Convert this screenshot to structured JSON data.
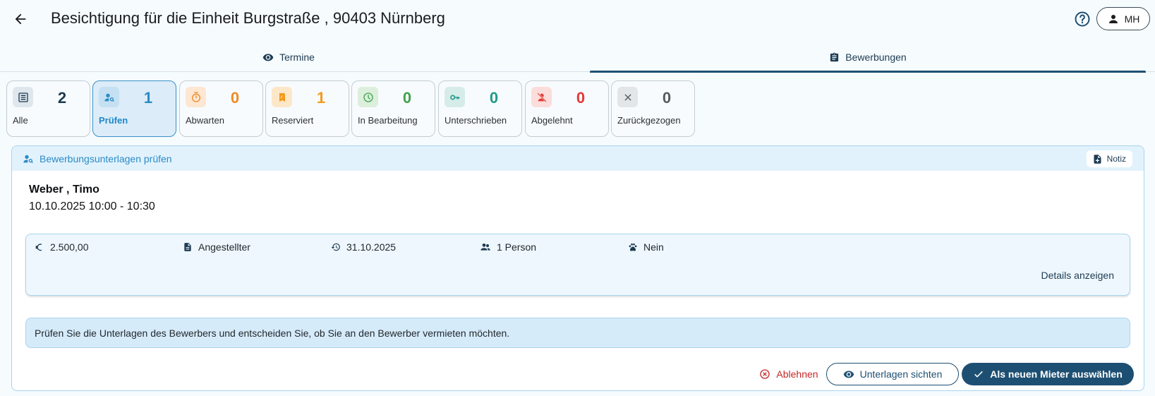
{
  "header": {
    "title": "Besichtigung für die Einheit Burgstraße , 90403 Nürnberg",
    "user_initials": "MH"
  },
  "tabs": [
    {
      "label": "Termine",
      "icon": "eye-icon",
      "active": false
    },
    {
      "label": "Bewerbungen",
      "icon": "clipboard-icon",
      "active": true
    }
  ],
  "status_cards": [
    {
      "label": "Alle",
      "count": "2",
      "icon": "list-icon",
      "color": "#1d3b52",
      "bg": "#dfe7ee",
      "active": false
    },
    {
      "label": "Prüfen",
      "count": "1",
      "icon": "person-search-icon",
      "color": "#2a8bc6",
      "bg": "#c5e0f3",
      "active": true
    },
    {
      "label": "Abwarten",
      "count": "0",
      "icon": "timer-icon",
      "color": "#f08a24",
      "bg": "#fde6d2",
      "active": false
    },
    {
      "label": "Reserviert",
      "count": "1",
      "icon": "bookmark-icon",
      "color": "#f29a1a",
      "bg": "#fde7c9",
      "active": false
    },
    {
      "label": "In Bearbeitung",
      "count": "0",
      "icon": "clock-icon",
      "color": "#3fa34d",
      "bg": "#dcefdc",
      "active": false
    },
    {
      "label": "Unterschrieben",
      "count": "0",
      "icon": "key-icon",
      "color": "#1f9a8a",
      "bg": "#d6ece9",
      "active": false
    },
    {
      "label": "Abgelehnt",
      "count": "0",
      "icon": "person-off-icon",
      "color": "#e53935",
      "bg": "#fbdddc",
      "active": false
    },
    {
      "label": "Zurückgezogen",
      "count": "0",
      "icon": "close-icon",
      "color": "#555b61",
      "bg": "#e3e6e8",
      "active": false
    }
  ],
  "panel": {
    "title": "Bewerbungsunterlagen prüfen",
    "note_label": "Notiz",
    "applicant_name": "Weber , Timo",
    "appointment": "10.10.2025 10:00 - 10:30",
    "info": {
      "income": "2.500,00",
      "employment": "Angestellter",
      "move_in": "31.10.2025",
      "persons": "1 Person",
      "pets": "Nein",
      "details_label": "Details anzeigen"
    },
    "hint": "Prüfen Sie die Unterlagen des Bewerbers und entscheiden Sie, ob Sie an den Bewerber vermieten möchten.",
    "actions": {
      "reject": "Ablehnen",
      "view_docs": "Unterlagen sichten",
      "select": "Als neuen Mieter auswählen"
    }
  },
  "colors": {
    "primary": "#1d4f72",
    "accent_blue": "#2a8bc6",
    "danger": "#c62828"
  }
}
